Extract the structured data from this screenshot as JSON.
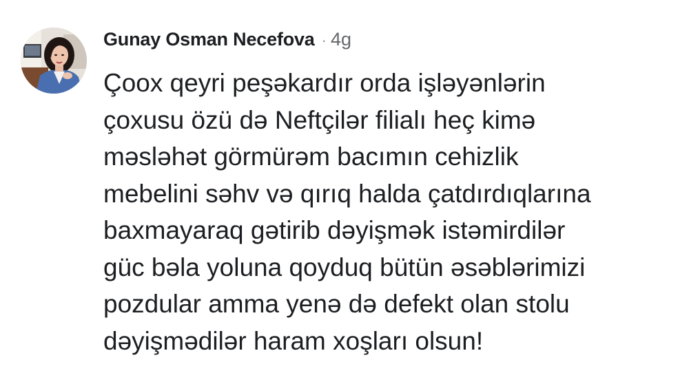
{
  "comment": {
    "author": "Gunay Osman Necefova",
    "separator": "·",
    "time": "4g",
    "lines": [
      "Çoox qeyri peşəkardır orda işləyənlərin",
      "çoxusu özü də Neftçilər filialı heç kimə",
      "məsləhət görmürəm bacımın cehizlik",
      "mebelini səhv və qırıq halda çatdırdıqlarına",
      "baxmayaraq gətirib dəyişmək istəmirdilər",
      "güc bəla yoluna qoyduq bütün əsəblərimizi",
      "pozdular amma yenə də defekt olan stolu",
      "dəyişmədilər haram xoşları olsun!"
    ]
  },
  "colors": {
    "text": "#1c1e21",
    "secondary": "#65676b",
    "avatar_jacket": "#4a6fb0"
  },
  "icons": {
    "avatar": "profile-photo"
  }
}
